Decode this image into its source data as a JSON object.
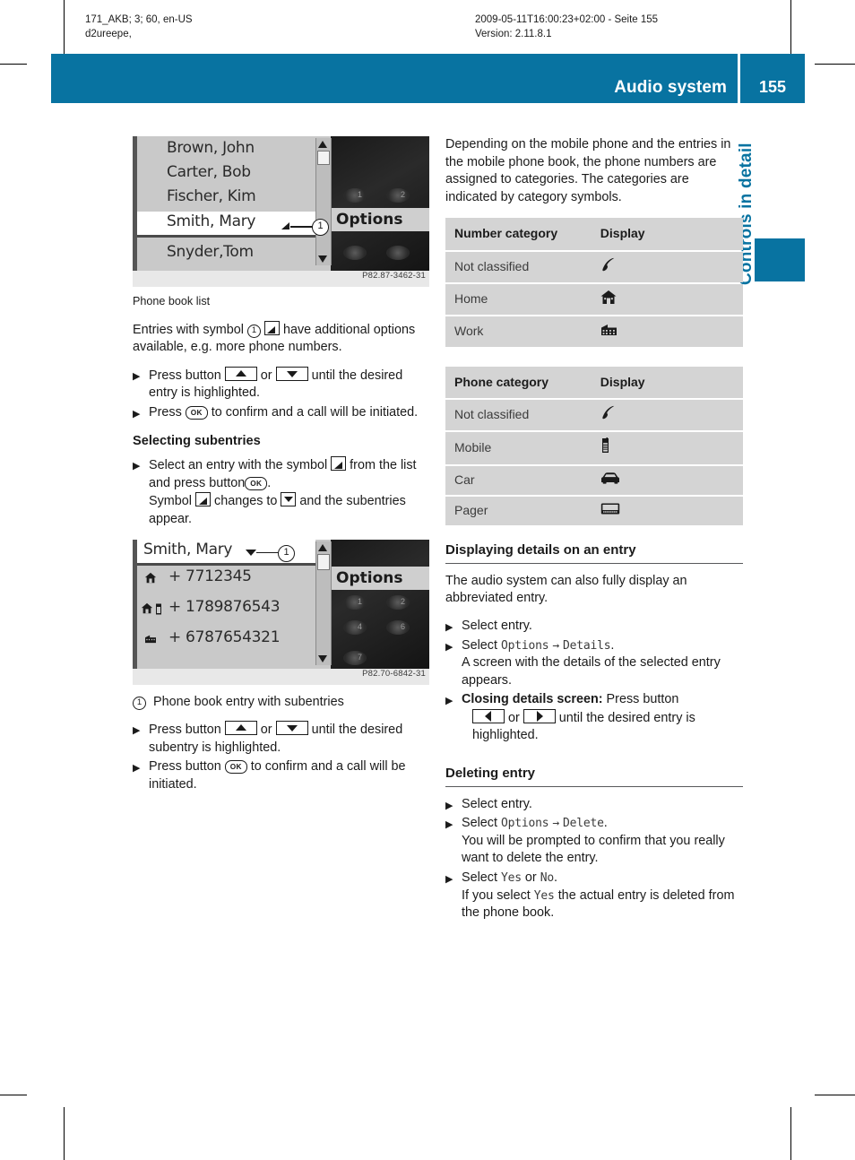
{
  "print_header": {
    "left": "171_AKB; 3; 60, en-US\nd2ureepe,",
    "right": "2009-05-11T16:00:23+02:00 - Seite 155\nVersion: 2.11.8.1"
  },
  "header": {
    "title": "Audio system",
    "page_number": "155",
    "accent_color": "#0873a1"
  },
  "side_tab": {
    "label": "Controls in detail"
  },
  "figure1": {
    "rows": [
      "Brown, John",
      "Carter, Bob",
      "Fischer, Kim",
      "Smith, Mary",
      "Snyder,Tom"
    ],
    "selected_row": "Smith, Mary",
    "options_label": "Options",
    "callout_number": "1",
    "image_code": "P82.87-3462-31",
    "caption": "Phone book list"
  },
  "figure2": {
    "title_row": "Smith, Mary",
    "entries": [
      "+ 7712345",
      "+ 1789876543",
      "+ 6787654321"
    ],
    "options_label": "Options",
    "callout_number": "1",
    "image_code": "P82.70-6842-31",
    "legend_number": "1",
    "legend_text": "Phone book entry with subentries"
  },
  "left_column": {
    "intro": {
      "part1": "Entries with symbol",
      "circled": "1",
      "part2": "have additional options available, e.g. more phone numbers."
    },
    "steps_1": [
      {
        "part1": "Press button",
        "part2": "or",
        "part3": "until the desired entry is highlighted."
      },
      {
        "part1": "Press",
        "part2": "to confirm and a call will be initiated."
      }
    ],
    "subentries_heading": "Selecting subentries",
    "subentries_step": {
      "part1": "Select an entry with the symbol",
      "part2": "from the list and press button",
      "part3": ".",
      "sub_part1": "Symbol",
      "sub_part2": "changes to",
      "sub_part3": "and the subentries appear."
    },
    "steps_2": [
      {
        "part1": "Press button",
        "part2": "or",
        "part3": "until the desired subentry is highlighted."
      },
      {
        "part1": "Press button",
        "part2": "to confirm and a call will be initiated."
      }
    ],
    "ok_label": "OK"
  },
  "right_column": {
    "intro": "Depending on the mobile phone and the entries in the mobile phone book, the phone numbers are assigned to categories. The categories are indicated by category symbols.",
    "number_table": {
      "headers": [
        "Number category",
        "Display"
      ],
      "rows": [
        {
          "label": "Not classified",
          "icon": "handset-icon"
        },
        {
          "label": "Home",
          "icon": "house-icon"
        },
        {
          "label": "Work",
          "icon": "office-building-icon"
        }
      ]
    },
    "phone_table": {
      "headers": [
        "Phone category",
        "Display"
      ],
      "rows": [
        {
          "label": "Not classified",
          "icon": "handset-icon"
        },
        {
          "label": "Mobile",
          "icon": "mobile-phone-icon"
        },
        {
          "label": "Car",
          "icon": "car-icon"
        },
        {
          "label": "Pager",
          "icon": "pager-icon"
        }
      ]
    },
    "details_section": {
      "heading": "Displaying details on an entry",
      "intro": "The audio system can also fully display an abbreviated entry.",
      "step1": "Select entry.",
      "step2_prefix": "Select",
      "step2_options": "Options",
      "step2_arrow": "→",
      "step2_target": "Details",
      "step2_period": ".",
      "step2_sub": "A screen with the details of the selected entry appears.",
      "step3_bold": "Closing details screen:",
      "step3_part1": "Press button",
      "step3_part2": "or",
      "step3_part3": "until the desired entry is highlighted."
    },
    "delete_section": {
      "heading": "Deleting entry",
      "step1": "Select entry.",
      "step2_prefix": "Select",
      "step2_options": "Options",
      "step2_arrow": "→",
      "step2_target": "Delete",
      "step2_period": ".",
      "step2_sub": "You will be prompted to confirm that you really want to delete the entry.",
      "step3_prefix": "Select",
      "step3_yes": "Yes",
      "step3_or": "or",
      "step3_no": "No",
      "step3_period": ".",
      "step3_sub_part1": "If you select",
      "step3_sub_yes": "Yes",
      "step3_sub_part2": "the actual entry is deleted from the phone book."
    }
  }
}
